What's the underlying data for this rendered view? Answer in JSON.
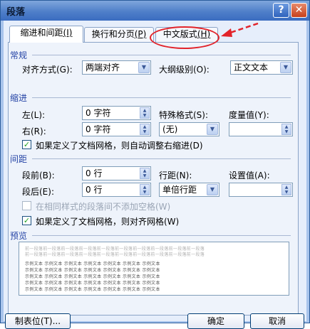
{
  "window": {
    "title": "段落"
  },
  "tabs": [
    {
      "label": "缩进和间距",
      "key": "(I)"
    },
    {
      "label": "换行和分页",
      "key": "(P)"
    },
    {
      "label": "中文版式",
      "key": "(H)"
    }
  ],
  "general": {
    "section": "常规",
    "alignment_label": "对齐方式(G):",
    "alignment_value": "两端对齐",
    "outline_label": "大纲级别(O):",
    "outline_value": "正文文本"
  },
  "indent": {
    "section": "缩进",
    "left_label": "左(L):",
    "left_value": "0 字符",
    "right_label": "右(R):",
    "right_value": "0 字符",
    "special_label": "特殊格式(S):",
    "special_value": "(无)",
    "by_label": "度量值(Y):",
    "by_value": "",
    "auto_adjust_label": "如果定义了文档网格，则自动调整右缩进(D)"
  },
  "spacing": {
    "section": "间距",
    "before_label": "段前(B):",
    "before_value": "0 行",
    "after_label": "段后(E):",
    "after_value": "0 行",
    "line_label": "行距(N):",
    "line_value": "单倍行距",
    "at_label": "设置值(A):",
    "at_value": "",
    "no_space_label": "在相同样式的段落间不添加空格(W)",
    "snap_grid_label": "如果定义了文档网格，则对齐网格(W)"
  },
  "preview": {
    "section": "预览",
    "prev_text": "前一段落前一段落前一段落前一段落前一段落前一段落前一段落前一段落前一段落前一段落",
    "sample_text": "示例文本 示例文本 示例文本 示例文本 示例文本 示例文本 示例文本"
  },
  "buttons": {
    "tabs": "制表位(T)...",
    "ok": "确定",
    "cancel": "取消"
  },
  "colors": {
    "highlight": "#e2232a",
    "section": "#2544a6"
  }
}
